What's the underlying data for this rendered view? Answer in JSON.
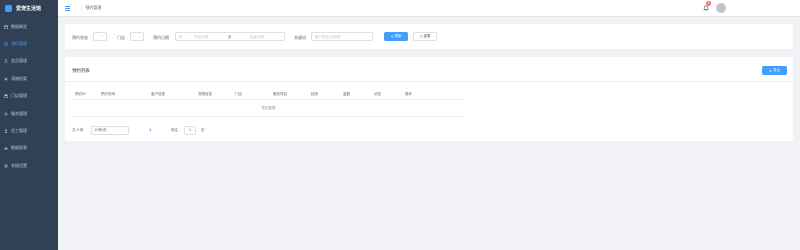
{
  "app": {
    "name": "爱宠生活馆"
  },
  "sidebar": {
    "items": [
      {
        "label": "数据概览",
        "icon": "dashboard-icon",
        "active": false
      },
      {
        "label": "预约管理",
        "icon": "calendar-icon",
        "active": true
      },
      {
        "label": "会员管理",
        "icon": "user-icon",
        "active": false
      },
      {
        "label": "宠物档案",
        "icon": "paw-icon",
        "active": false
      },
      {
        "label": "门店管理",
        "icon": "shop-icon",
        "active": false
      },
      {
        "label": "服务管理",
        "icon": "gear-icon",
        "active": false
      },
      {
        "label": "员工管理",
        "icon": "staff-icon",
        "active": false
      },
      {
        "label": "数据报表",
        "icon": "report-icon",
        "active": false
      },
      {
        "label": "系统设置",
        "icon": "settings-icon",
        "active": false
      }
    ]
  },
  "header": {
    "breadcrumb": [
      "预约管理"
    ],
    "notification_count": "5"
  },
  "filter": {
    "status_label": "预约状态",
    "store_label": "门店",
    "date_label": "预约日期",
    "date_start_placeholder": "开始日期",
    "date_separator": "至",
    "date_end_placeholder": "结束日期",
    "keyword_label": "关键词",
    "keyword_placeholder": "客户姓名/手机号",
    "search_button": "搜索",
    "reset_button": "重置"
  },
  "list": {
    "title": "预约列表",
    "export_button": "导出",
    "columns": [
      "预约ID",
      "预约时间",
      "客户信息",
      "宠物信息",
      "门店",
      "服务项目",
      "技师",
      "金额",
      "状态",
      "操作"
    ],
    "empty_text": "暂无数据"
  },
  "pagination": {
    "total_text": "共 0 条",
    "page_size": "10条/页",
    "current_page": "1",
    "goto_label": "前往",
    "goto_value": "1",
    "goto_unit": "页"
  },
  "colors": {
    "sidebar_bg": "#304156",
    "accent": "#409eff",
    "badge": "#f56c6c"
  }
}
